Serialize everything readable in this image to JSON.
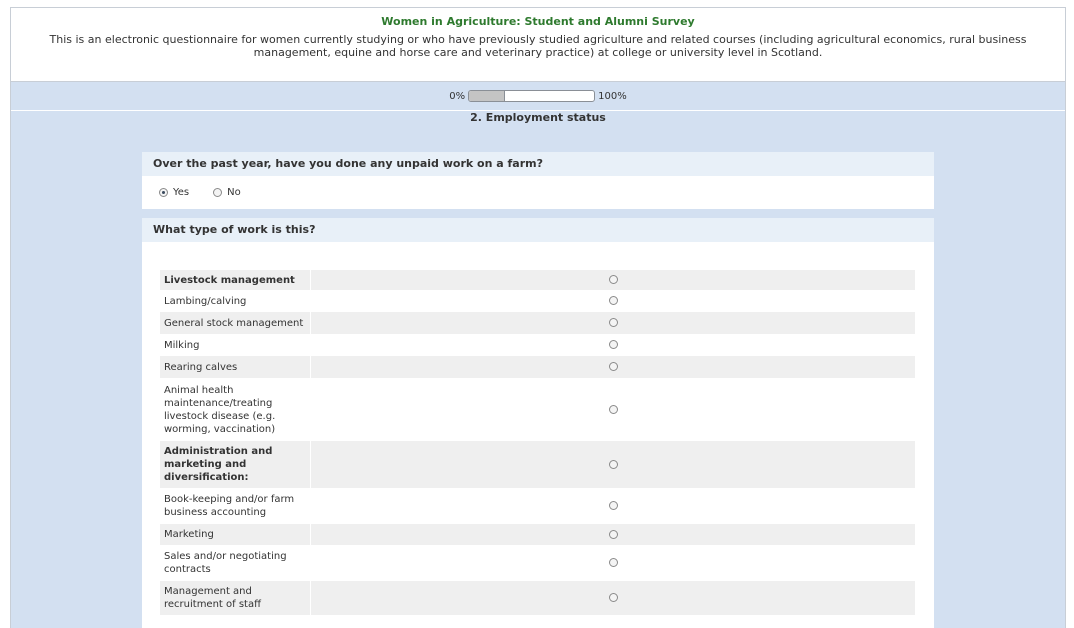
{
  "header": {
    "title": "Women in Agriculture: Student and Alumni Survey",
    "description": "This is an electronic questionnaire for women currently studying or who have previously studied agriculture and related courses (including agricultural economics, rural business management, equine and horse care and  veterinary practice) at college or university level in Scotland."
  },
  "progress": {
    "start_label": "0%",
    "end_label": "100%",
    "value_percent": 28
  },
  "section": {
    "title": "2. Employment status"
  },
  "q1": {
    "question": "Over the past year, have you done any unpaid work on a farm?",
    "options": [
      {
        "label": "Yes",
        "checked": true
      },
      {
        "label": "No",
        "checked": false
      }
    ]
  },
  "q2": {
    "question": "What type of work is this?",
    "rows": [
      {
        "label": "Livestock management",
        "heading": true
      },
      {
        "label": "Lambing/calving"
      },
      {
        "label": "General stock management"
      },
      {
        "label": "Milking"
      },
      {
        "label": "Rearing calves"
      },
      {
        "label": "Animal health maintenance/treating livestock disease (e.g. worming, vaccination)"
      },
      {
        "label": "Administration and marketing and diversification:",
        "heading": true
      },
      {
        "label": "Book-keeping and/or farm business accounting"
      },
      {
        "label": "Marketing"
      },
      {
        "label": "Sales and/or negotiating contracts"
      },
      {
        "label": "Management and recruitment of staff"
      }
    ]
  }
}
